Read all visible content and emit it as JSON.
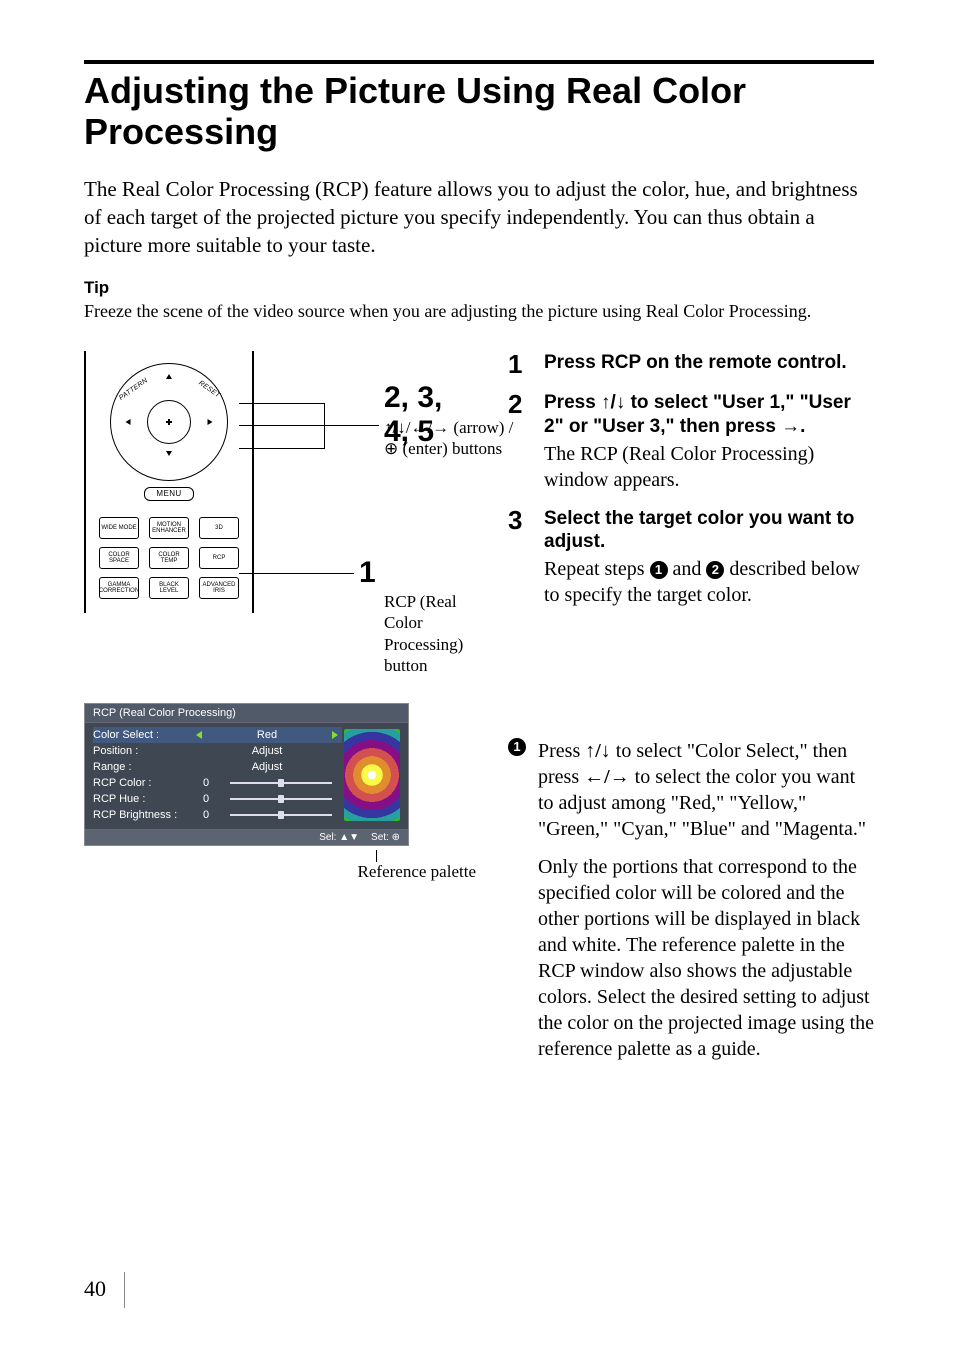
{
  "page_number": "40",
  "title": "Adjusting the Picture Using Real Color Processing",
  "intro": "The Real Color Processing (RCP) feature allows you to adjust the color, hue, and brightness of each target of the projected picture you specify independently. You can thus obtain a picture more suitable to your taste.",
  "tip": {
    "label": "Tip",
    "body": "Freeze the scene of the video source when you are adjusting the picture using Real Color Processing."
  },
  "remote": {
    "menu_label": "MENU",
    "pattern_label": "PATTERN",
    "reset_label": "RESET",
    "buttons": [
      "WIDE MODE",
      "MOTION ENHANCER",
      "3D",
      "COLOR SPACE",
      "COLOR TEMP",
      "RCP",
      "GAMMA CORRECTION",
      "BLACK LEVEL",
      "ADVANCED IRIS"
    ],
    "callout_top": "2, 3, 4, 5",
    "callout_top_sub": "↑/↓/←/→ (arrow) / ⊕ (enter) buttons",
    "callout_bottom": "1",
    "callout_bottom_sub": "RCP (Real Color Processing) button"
  },
  "rcp_window": {
    "title": "RCP (Real Color Processing)",
    "rows": [
      {
        "label": "Color Select :",
        "value": "Red",
        "type": "select"
      },
      {
        "label": "Position :",
        "value": "Adjust",
        "type": "text"
      },
      {
        "label": "Range :",
        "value": "Adjust",
        "type": "text"
      },
      {
        "label": "RCP Color :",
        "num": "0",
        "type": "slider"
      },
      {
        "label": "RCP Hue :",
        "num": "0",
        "type": "slider"
      },
      {
        "label": "RCP Brightness :",
        "num": "0",
        "type": "slider"
      }
    ],
    "footer_sel": "Sel:",
    "footer_set": "Set:",
    "reference_label": "Reference palette"
  },
  "steps": [
    {
      "num": "1",
      "head": "Press RCP on the remote control."
    },
    {
      "num": "2",
      "head_parts": [
        "Press ",
        "UPDN",
        " to select \"User 1,\" \"User 2\" or \"User 3,\" then press ",
        "RIGHT",
        "."
      ],
      "para": "The RCP (Real Color Processing) window appears."
    },
    {
      "num": "3",
      "head": "Select the target color you want to adjust.",
      "para_parts": [
        "Repeat steps ",
        "C1",
        " and ",
        "C2",
        " described below to specify the target color."
      ]
    }
  ],
  "substep": {
    "bullet": "1",
    "p1_parts": [
      "Press ",
      "UPDN",
      " to select \"Color Select,\" then press ",
      "LEFTRIGHT",
      " to select the color you want to adjust among \"Red,\" \"Yellow,\" \"Green,\" \"Cyan,\" \"Blue\" and \"Magenta.\""
    ],
    "p2": "Only the portions that correspond to the specified color will be colored and the other portions will be displayed in black and white. The reference palette in the RCP window also shows the adjustable colors. Select the desired setting to adjust the color on the projected image using the reference palette as a guide."
  }
}
